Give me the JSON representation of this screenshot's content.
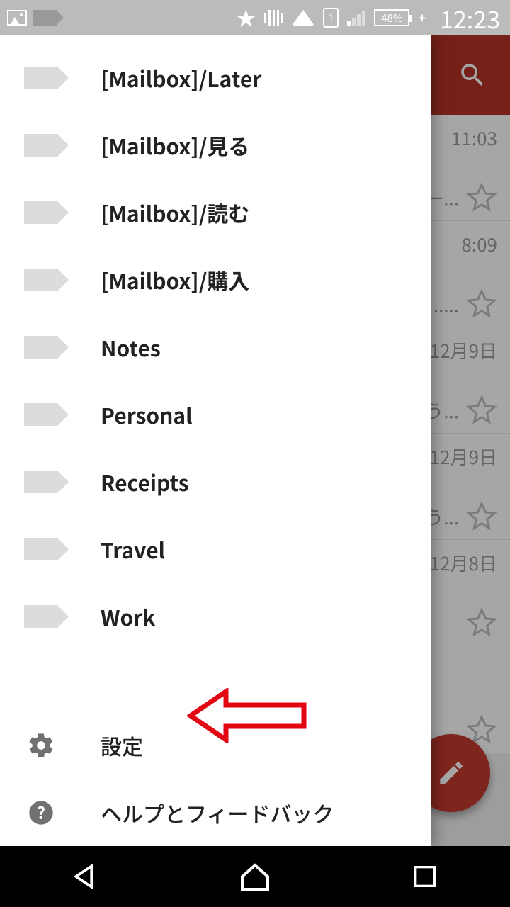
{
  "status": {
    "battery_pct": "48%",
    "sim_slot": "1",
    "clock": "12:23"
  },
  "drawer": {
    "top_label": "[Mailbox]",
    "labels": [
      "[Mailbox]/Later",
      "[Mailbox]/見る",
      "[Mailbox]/読む",
      "[Mailbox]/購入",
      "Notes",
      "Personal",
      "Receipts",
      "Travel",
      "Work"
    ],
    "settings": "設定",
    "help": "ヘルプとフィードバック"
  },
  "inbox_peek": {
    "rows": [
      {
        "time": "11:03",
        "snippet": "ー..."
      },
      {
        "time": "8:09",
        "snippet": "....."
      },
      {
        "time": "12月9日",
        "snippet": "う..."
      },
      {
        "time": "12月9日",
        "snippet": "う..."
      },
      {
        "time": "12月8日",
        "snippet": ""
      }
    ]
  },
  "annotation": {
    "points_to": "settings",
    "color": "#e30613"
  }
}
